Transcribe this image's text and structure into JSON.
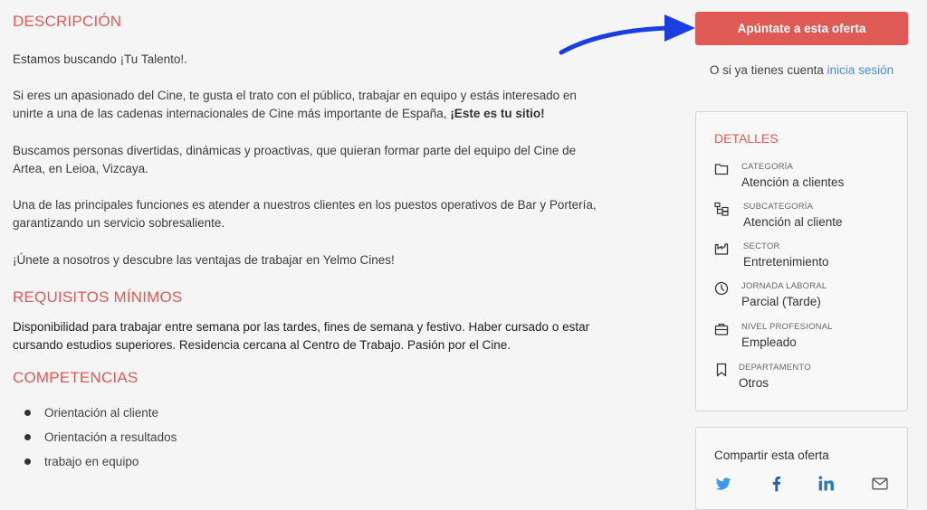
{
  "description": {
    "title": "DESCRIPCIÓN",
    "p1": "Estamos buscando ¡Tu Talento!.",
    "p2_part1": "Si eres un apasionado del Cine, te gusta el trato con el público, trabajar en equipo y estás interesado en unirte a una de las cadenas internacionales de Cine más importante de España, ",
    "p2_bold": "¡Este es tu sitio!",
    "p3": "Buscamos personas divertidas, dinámicas y proactivas, que quieran formar parte del equipo del Cine de Artea, en Leioa, Vizcaya.",
    "p4": "Una de las principales funciones es atender a nuestros clientes en los puestos operativos de Bar y Portería, garantizando un servicio sobresaliente.",
    "p5": "¡Únete a nosotros y descubre las ventajas de trabajar en Yelmo Cines!"
  },
  "requirements": {
    "title": "REQUISITOS MÍNIMOS",
    "text": "Disponibilidad para trabajar entre semana por las tardes, fines de semana y festivo. Haber cursado o estar cursando estudios superiores. Residencia cercana al Centro de Trabajo. Pasión por el Cine."
  },
  "competencies": {
    "title": "COMPETENCIAS",
    "items": [
      "Orientación al cliente",
      "Orientación a resultados",
      "trabajo en equipo"
    ]
  },
  "sidebar": {
    "apply_label": "Apúntate a esta oferta",
    "login_prefix": "O si ya tienes cuenta ",
    "login_link": "inicia sesión",
    "details_title": "DETALLES",
    "details": [
      {
        "label": "CATEGORÍA",
        "value": "Atención a clientes",
        "icon": "folder-icon"
      },
      {
        "label": "SUBCATEGORÍA",
        "value": "Atención al cliente",
        "icon": "subcategory-icon"
      },
      {
        "label": "SECTOR",
        "value": "Entretenimiento",
        "icon": "factory-icon"
      },
      {
        "label": "JORNADA LABORAL",
        "value": "Parcial (Tarde)",
        "icon": "clock-icon"
      },
      {
        "label": "NIVEL PROFESIONAL",
        "value": "Empleado",
        "icon": "briefcase-icon"
      },
      {
        "label": "DEPARTAMENTO",
        "value": "Otros",
        "icon": "bookmark-icon"
      }
    ],
    "share_title": "Compartir esta oferta",
    "share_icons": [
      "twitter-icon",
      "facebook-icon",
      "linkedin-icon",
      "email-icon"
    ]
  },
  "colors": {
    "accent": "#e05a55",
    "link": "#4a8fd6",
    "annotation_arrow": "#1a3fe0",
    "twitter": "#3d9ae8",
    "facebook": "#2c5fa8",
    "linkedin": "#2b78b8"
  }
}
